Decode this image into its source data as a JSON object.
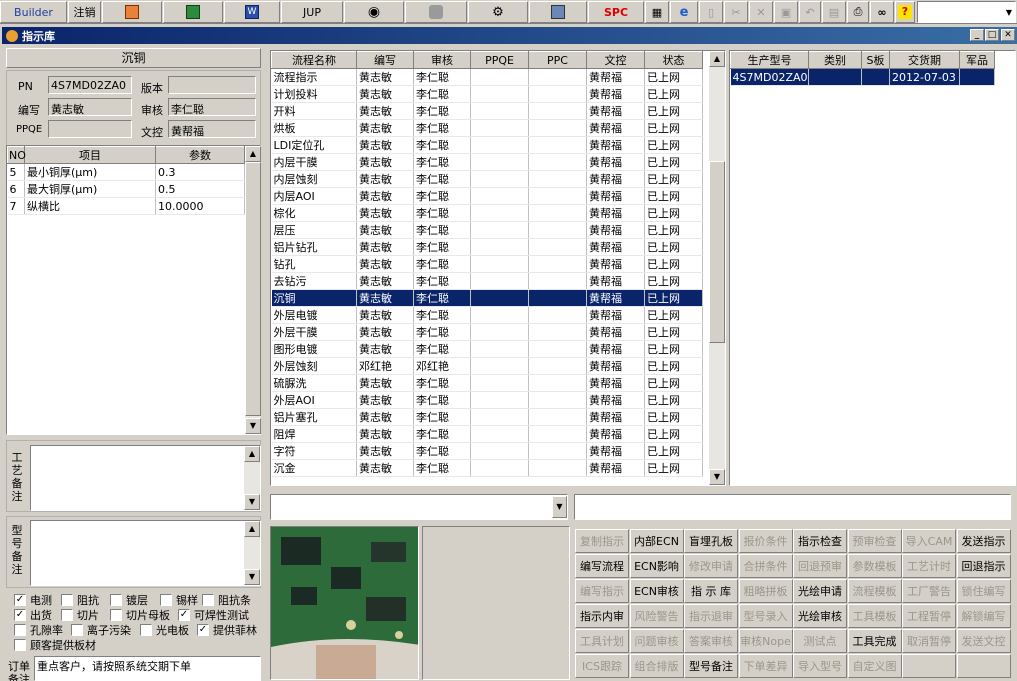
{
  "toolbar": {
    "builder": "Builder",
    "logout": "注销",
    "jup": "JUP",
    "spc": "SPC"
  },
  "window": {
    "title": "指示库"
  },
  "left": {
    "process_name": "沉铜",
    "pn_label": "PN",
    "pn_value": "4S7MD02ZA0",
    "version_label": "版本",
    "version_value": "",
    "author_label": "编写",
    "author_value": "黄志敏",
    "review_label": "审核",
    "review_value": "李仁聪",
    "ppqe_label": "PPQE",
    "ppqe_value": "",
    "doc_label": "文控",
    "doc_value": "黄帮福",
    "param_headers": [
      "NO",
      "项目",
      "参数"
    ],
    "params": [
      {
        "no": "5",
        "item": "最小铜厚(μm)",
        "val": "0.3"
      },
      {
        "no": "6",
        "item": "最大铜厚(μm)",
        "val": "0.5"
      },
      {
        "no": "7",
        "item": "纵横比",
        "val": "10.0000"
      }
    ],
    "craft_note_label": "工艺备注",
    "model_note_label": "型号备注",
    "order_note_label": "订单备注",
    "order_note_value": "重点客户，请按照系统交期下单"
  },
  "checks": [
    {
      "label": "电测",
      "checked": true
    },
    {
      "label": "阻抗",
      "checked": false
    },
    {
      "label": "镀层",
      "checked": false
    },
    {
      "label": "锡样",
      "checked": false
    },
    {
      "label": "阻抗条",
      "checked": false
    },
    {
      "label": "出货",
      "checked": true
    },
    {
      "label": "切片",
      "checked": false
    },
    {
      "label": "切片母板",
      "checked": false
    },
    {
      "label": "可焊性测试",
      "checked": true
    },
    {
      "label": "孔隙率",
      "checked": false
    },
    {
      "label": "离子污染",
      "checked": false
    },
    {
      "label": "光电板",
      "checked": false
    },
    {
      "label": "提供菲林",
      "checked": true
    },
    {
      "label": "顾客提供板材",
      "checked": false
    }
  ],
  "process": {
    "headers": [
      "流程名称",
      "编写",
      "审核",
      "PPQE",
      "PPC",
      "文控",
      "状态"
    ],
    "rows": [
      [
        "流程指示",
        "黄志敏",
        "李仁聪",
        "",
        "",
        "黄帮福",
        "已上网"
      ],
      [
        "计划投料",
        "黄志敏",
        "李仁聪",
        "",
        "",
        "黄帮福",
        "已上网"
      ],
      [
        "开料",
        "黄志敏",
        "李仁聪",
        "",
        "",
        "黄帮福",
        "已上网"
      ],
      [
        "烘板",
        "黄志敏",
        "李仁聪",
        "",
        "",
        "黄帮福",
        "已上网"
      ],
      [
        "LDI定位孔",
        "黄志敏",
        "李仁聪",
        "",
        "",
        "黄帮福",
        "已上网"
      ],
      [
        "内层干膜",
        "黄志敏",
        "李仁聪",
        "",
        "",
        "黄帮福",
        "已上网"
      ],
      [
        "内层蚀刻",
        "黄志敏",
        "李仁聪",
        "",
        "",
        "黄帮福",
        "已上网"
      ],
      [
        "内层AOI",
        "黄志敏",
        "李仁聪",
        "",
        "",
        "黄帮福",
        "已上网"
      ],
      [
        "棕化",
        "黄志敏",
        "李仁聪",
        "",
        "",
        "黄帮福",
        "已上网"
      ],
      [
        "层压",
        "黄志敏",
        "李仁聪",
        "",
        "",
        "黄帮福",
        "已上网"
      ],
      [
        "铝片钻孔",
        "黄志敏",
        "李仁聪",
        "",
        "",
        "黄帮福",
        "已上网"
      ],
      [
        "钻孔",
        "黄志敏",
        "李仁聪",
        "",
        "",
        "黄帮福",
        "已上网"
      ],
      [
        "去钻污",
        "黄志敏",
        "李仁聪",
        "",
        "",
        "黄帮福",
        "已上网"
      ],
      [
        "沉铜",
        "黄志敏",
        "李仁聪",
        "",
        "",
        "黄帮福",
        "已上网"
      ],
      [
        "外层电镀",
        "黄志敏",
        "李仁聪",
        "",
        "",
        "黄帮福",
        "已上网"
      ],
      [
        "外层干膜",
        "黄志敏",
        "李仁聪",
        "",
        "",
        "黄帮福",
        "已上网"
      ],
      [
        "图形电镀",
        "黄志敏",
        "李仁聪",
        "",
        "",
        "黄帮福",
        "已上网"
      ],
      [
        "外层蚀刻",
        "邓红艳",
        "邓红艳",
        "",
        "",
        "黄帮福",
        "已上网"
      ],
      [
        "硫脲洗",
        "黄志敏",
        "李仁聪",
        "",
        "",
        "黄帮福",
        "已上网"
      ],
      [
        "外层AOI",
        "黄志敏",
        "李仁聪",
        "",
        "",
        "黄帮福",
        "已上网"
      ],
      [
        "铝片塞孔",
        "黄志敏",
        "李仁聪",
        "",
        "",
        "黄帮福",
        "已上网"
      ],
      [
        "阻焊",
        "黄志敏",
        "李仁聪",
        "",
        "",
        "黄帮福",
        "已上网"
      ],
      [
        "字符",
        "黄志敏",
        "李仁聪",
        "",
        "",
        "黄帮福",
        "已上网"
      ],
      [
        "沉金",
        "黄志敏",
        "李仁聪",
        "",
        "",
        "黄帮福",
        "已上网"
      ]
    ],
    "selected_index": 13
  },
  "orders": {
    "headers": [
      "生产型号",
      "类别",
      "S板",
      "交货期",
      "军品"
    ],
    "rows": [
      [
        "4S7MD02ZA0",
        "",
        "",
        "2012-07-03",
        ""
      ]
    ]
  },
  "buttons": [
    [
      {
        "t": "复制指示",
        "s": "dis"
      },
      {
        "t": "内部ECN",
        "s": "n"
      },
      {
        "t": "盲埋孔板",
        "s": "n"
      },
      {
        "t": "报价条件",
        "s": "dis"
      },
      {
        "t": "指示检查",
        "s": "n"
      },
      {
        "t": "预审检查",
        "s": "dis"
      },
      {
        "t": "导入CAM",
        "s": "dis"
      },
      {
        "t": "发送指示",
        "s": "n"
      }
    ],
    [
      {
        "t": "编写流程",
        "s": "n"
      },
      {
        "t": "ECN影响",
        "s": "n"
      },
      {
        "t": "修改申请",
        "s": "dis"
      },
      {
        "t": "合拼条件",
        "s": "dis"
      },
      {
        "t": "回退预审",
        "s": "dis"
      },
      {
        "t": "参数模板",
        "s": "dis"
      },
      {
        "t": "工艺计时",
        "s": "dis"
      },
      {
        "t": "回退指示",
        "s": "n"
      }
    ],
    [
      {
        "t": "编写指示",
        "s": "dis"
      },
      {
        "t": "ECN审核",
        "s": "n"
      },
      {
        "t": "指 示 库",
        "s": "n"
      },
      {
        "t": "粗略拼板",
        "s": "dis"
      },
      {
        "t": "光绘申请",
        "s": "n"
      },
      {
        "t": "流程模板",
        "s": "dis"
      },
      {
        "t": "工厂警告",
        "s": "dis"
      },
      {
        "t": "锁住编写",
        "s": "dis"
      }
    ],
    [
      {
        "t": "指示内审",
        "s": "n"
      },
      {
        "t": "风险警告",
        "s": "dis"
      },
      {
        "t": "指示退审",
        "s": "dis"
      },
      {
        "t": "型号录入",
        "s": "dis"
      },
      {
        "t": "光绘审核",
        "s": "n"
      },
      {
        "t": "工具模板",
        "s": "dis"
      },
      {
        "t": "工程暂停",
        "s": "dis"
      },
      {
        "t": "解锁编写",
        "s": "dis"
      }
    ],
    [
      {
        "t": "工具计划",
        "s": "dis"
      },
      {
        "t": "问题审核",
        "s": "dis"
      },
      {
        "t": "答案审核",
        "s": "dis"
      },
      {
        "t": "审核Nope",
        "s": "dis"
      },
      {
        "t": "测试点",
        "s": "dis"
      },
      {
        "t": "工具完成",
        "s": "n"
      },
      {
        "t": "取消暂停",
        "s": "dis"
      },
      {
        "t": "发送文控",
        "s": "dis"
      }
    ],
    [
      {
        "t": "ICS跟踪",
        "s": "dis"
      },
      {
        "t": "组合排版",
        "s": "dis"
      },
      {
        "t": "型号备注",
        "s": "n"
      },
      {
        "t": "下单差异",
        "s": "dis"
      },
      {
        "t": "导入型号",
        "s": "dis"
      },
      {
        "t": "自定义图",
        "s": "dis"
      },
      {
        "t": "",
        "s": "n"
      },
      {
        "t": "",
        "s": "n"
      }
    ]
  ],
  "colors": {
    "selection": "#0a246a",
    "face": "#d4d0c8"
  }
}
